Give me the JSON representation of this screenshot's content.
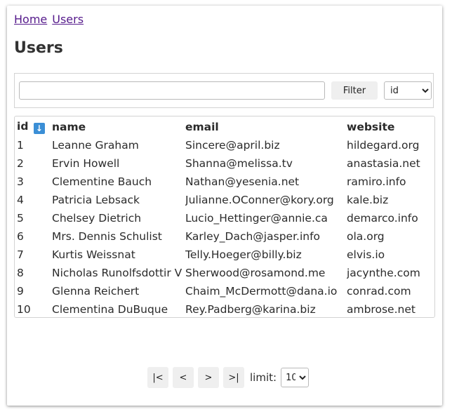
{
  "breadcrumb": {
    "items": [
      "Home",
      "Users"
    ]
  },
  "page": {
    "title": "Users"
  },
  "filter": {
    "input_value": "",
    "button_label": "Filter",
    "field_select": {
      "selected": "id",
      "options": [
        "id"
      ]
    }
  },
  "table": {
    "columns": [
      "id",
      "name",
      "email",
      "website"
    ],
    "sort_icon": "arrow-down-icon",
    "rows": [
      [
        "1",
        "Leanne Graham",
        "Sincere@april.biz",
        "hildegard.org"
      ],
      [
        "2",
        "Ervin Howell",
        "Shanna@melissa.tv",
        "anastasia.net"
      ],
      [
        "3",
        "Clementine Bauch",
        "Nathan@yesenia.net",
        "ramiro.info"
      ],
      [
        "4",
        "Patricia Lebsack",
        "Julianne.OConner@kory.org",
        "kale.biz"
      ],
      [
        "5",
        "Chelsey Dietrich",
        "Lucio_Hettinger@annie.ca",
        "demarco.info"
      ],
      [
        "6",
        "Mrs. Dennis Schulist",
        "Karley_Dach@jasper.info",
        "ola.org"
      ],
      [
        "7",
        "Kurtis Weissnat",
        "Telly.Hoeger@billy.biz",
        "elvis.io"
      ],
      [
        "8",
        "Nicholas Runolfsdottir V",
        "Sherwood@rosamond.me",
        "jacynthe.com"
      ],
      [
        "9",
        "Glenna Reichert",
        "Chaim_McDermott@dana.io",
        "conrad.com"
      ],
      [
        "10",
        "Clementina DuBuque",
        "Rey.Padberg@karina.biz",
        "ambrose.net"
      ]
    ]
  },
  "pagination": {
    "first_label": "|<",
    "prev_label": "<",
    "next_label": ">",
    "last_label": ">|",
    "limit_label": "limit:",
    "limit_value": "10"
  }
}
